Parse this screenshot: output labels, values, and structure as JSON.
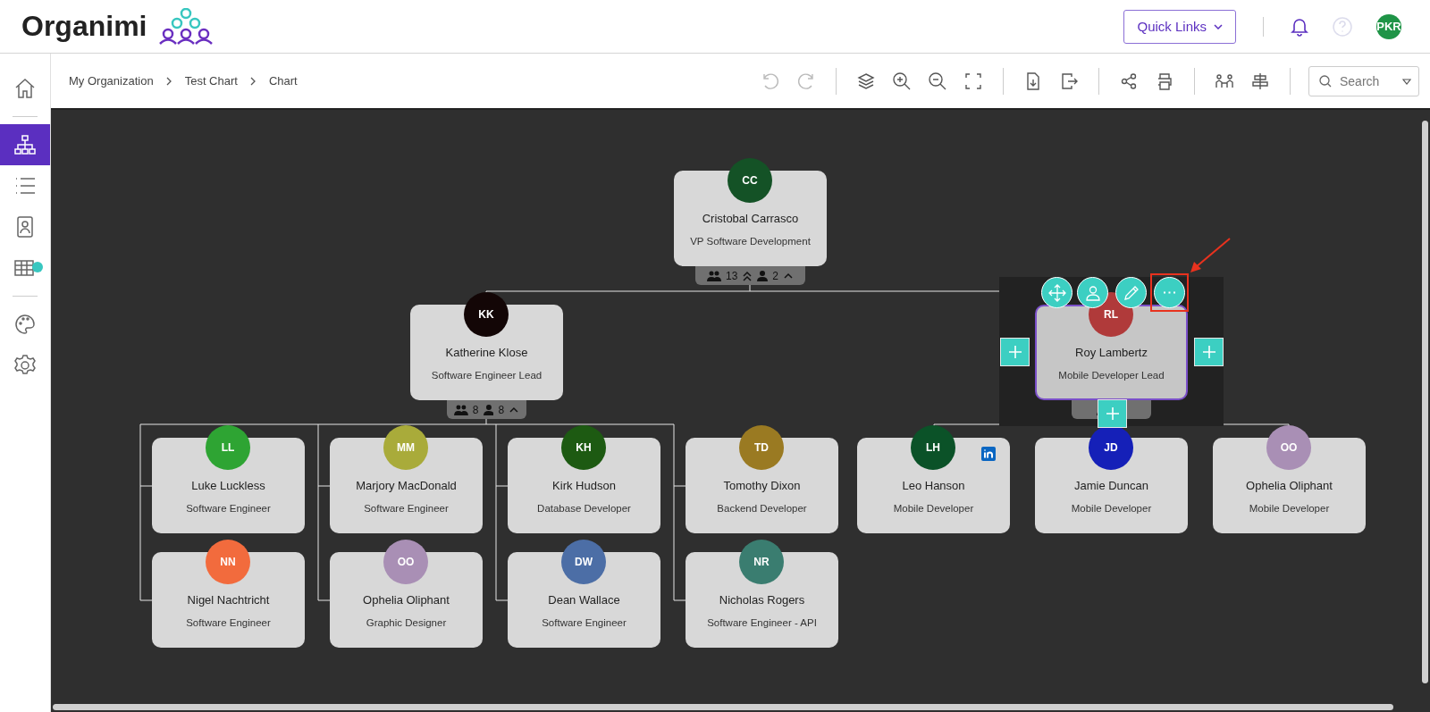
{
  "header": {
    "logo": "Organimi",
    "quick_links": "Quick Links",
    "user_initials": "PKR"
  },
  "sidebar": {
    "groups": [
      [
        {
          "kind": "home",
          "selected": false
        }
      ],
      [
        {
          "kind": "org",
          "selected": true,
          "dot": false
        },
        {
          "kind": "list",
          "selected": false,
          "dot": false
        },
        {
          "kind": "contact",
          "selected": false,
          "dot": false
        },
        {
          "kind": "table",
          "selected": false,
          "dot": true
        }
      ],
      [
        {
          "kind": "palette",
          "selected": false
        },
        {
          "kind": "settings",
          "selected": false
        }
      ]
    ]
  },
  "breadcrumbs": [
    "My Organization",
    "Test Chart",
    "Chart"
  ],
  "toolbar": [
    [
      {
        "kind": "undo",
        "disabled": true
      },
      {
        "kind": "redo",
        "disabled": true
      }
    ],
    [
      {
        "kind": "layers",
        "disabled": false
      },
      {
        "kind": "zoom_in",
        "disabled": false
      },
      {
        "kind": "zoom_out",
        "disabled": false
      },
      {
        "kind": "fit",
        "disabled": false
      }
    ],
    [
      {
        "kind": "export",
        "disabled": false
      },
      {
        "kind": "exit",
        "disabled": false
      }
    ],
    [
      {
        "kind": "share",
        "disabled": false
      },
      {
        "kind": "print",
        "disabled": false
      }
    ],
    [
      {
        "kind": "people",
        "disabled": false
      },
      {
        "kind": "align",
        "disabled": false
      }
    ]
  ],
  "search": {
    "placeholder": "Search"
  },
  "chart": {
    "nodes": [
      {
        "initials": "CC",
        "name": "Cristobal Carrasco",
        "title": "VP Software Development",
        "color": "#145226",
        "linkedin": false,
        "selected": false,
        "badge": {
          "team": "13",
          "direct": "2",
          "expand_all": true
        },
        "children": [
          {
            "initials": "KK",
            "name": "Katherine Klose",
            "title": "Software Engineer Lead",
            "color": "#130606",
            "linkedin": false,
            "selected": false,
            "badge": {
              "team": "8",
              "direct": "8",
              "expand_all": false
            },
            "children": [
              {
                "initials": "LL",
                "name": "Luke Luckless",
                "title": "Software Engineer",
                "color": "#2ea433",
                "linkedin": false,
                "selected": false
              },
              {
                "initials": "MM",
                "name": "Marjory MacDonald",
                "title": "Software Engineer",
                "color": "#a9ab3a",
                "linkedin": false,
                "selected": false
              },
              {
                "initials": "KH",
                "name": "Kirk Hudson",
                "title": "Database Developer",
                "color": "#1d5a12",
                "linkedin": false,
                "selected": false
              },
              {
                "initials": "TD",
                "name": "Tomothy Dixon",
                "title": "Backend Developer",
                "color": "#9a7a22",
                "linkedin": false,
                "selected": false
              },
              {
                "initials": "NN",
                "name": "Nigel Nachtricht",
                "title": "Software Engineer",
                "color": "#f26b3d",
                "linkedin": false,
                "selected": false
              },
              {
                "initials": "OO",
                "name": "Ophelia Oliphant",
                "title": "Graphic Designer",
                "color": "#a98fb5",
                "linkedin": false,
                "selected": false
              },
              {
                "initials": "DW",
                "name": "Dean Wallace",
                "title": "Software Engineer",
                "color": "#4c6ea6",
                "linkedin": false,
                "selected": false
              },
              {
                "initials": "NR",
                "name": "Nicholas Rogers",
                "title": "Software Engineer - API",
                "color": "#3a7d70",
                "linkedin": false,
                "selected": false
              }
            ]
          },
          {
            "initials": "RL",
            "name": "Roy Lambertz",
            "title": "Mobile Developer Lead",
            "color": "#b03a3a",
            "linkedin": false,
            "selected": true,
            "badge": {
              "expand_all": false
            },
            "children": [
              {
                "initials": "LH",
                "name": "Leo Hanson",
                "title": "Mobile Developer",
                "color": "#0b5228",
                "linkedin": true,
                "selected": false
              },
              {
                "initials": "JD",
                "name": "Jamie Duncan",
                "title": "Mobile Developer",
                "color": "#1520b8",
                "linkedin": false,
                "selected": false
              },
              {
                "initials": "OO",
                "name": "Ophelia Oliphant",
                "title": "Mobile Developer",
                "color": "#a98fb5",
                "linkedin": false,
                "selected": false
              }
            ]
          }
        ]
      }
    ],
    "node_actions": [
      {
        "kind": "move",
        "highlighted": false
      },
      {
        "kind": "profile",
        "highlighted": false
      },
      {
        "kind": "edit",
        "highlighted": false
      },
      {
        "kind": "more",
        "highlighted": true
      }
    ]
  }
}
